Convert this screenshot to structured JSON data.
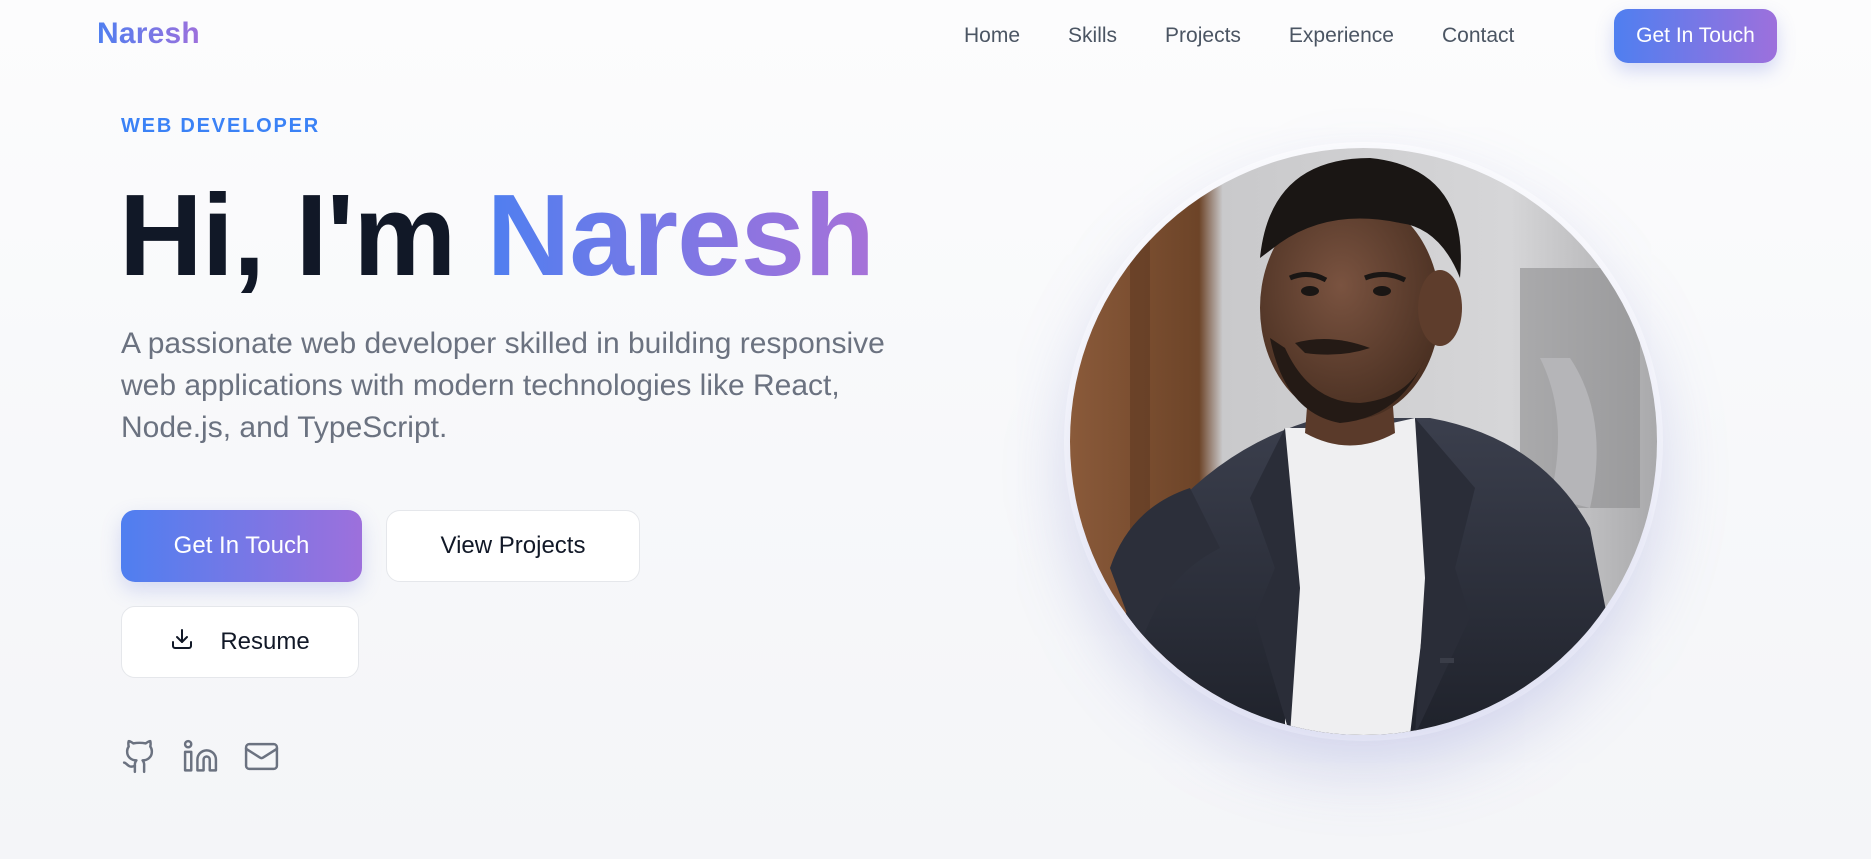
{
  "nav": {
    "brand": "Naresh",
    "links": [
      "Home",
      "Skills",
      "Projects",
      "Experience",
      "Contact"
    ],
    "cta_label": "Get In Touch"
  },
  "hero": {
    "eyebrow": "WEB DEVELOPER",
    "title_prefix": "Hi, I'm ",
    "title_name": "Naresh",
    "description": "A passionate web developer skilled in building responsive web applications with modern technologies like React, Node.js, and TypeScript.",
    "primary_button": "Get In Touch",
    "secondary_button": "View Projects",
    "resume_button": "Resume"
  },
  "socials": [
    {
      "icon": "github-icon"
    },
    {
      "icon": "linkedin-icon"
    },
    {
      "icon": "mail-icon"
    }
  ],
  "colors": {
    "gradient_start": "#4f7ff0",
    "gradient_end": "#9d70dc",
    "eyebrow": "#3b82f6",
    "heading": "#111827",
    "muted_text": "#6b7280"
  }
}
